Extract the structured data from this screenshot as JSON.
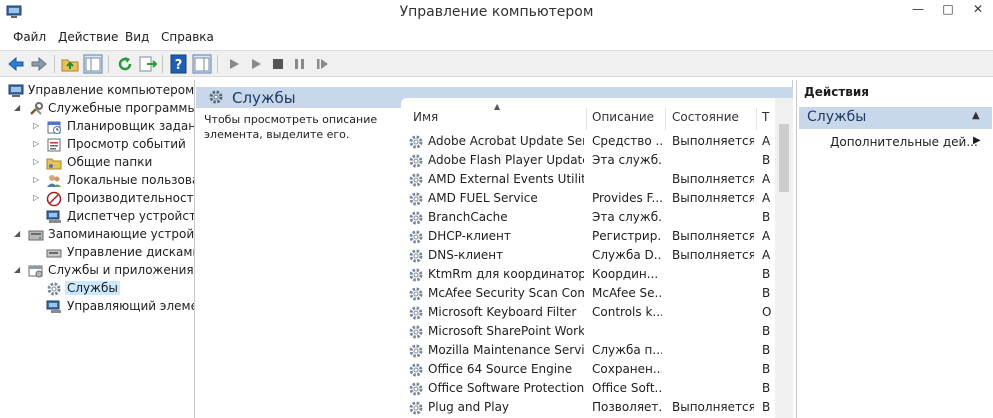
{
  "window": {
    "title": "Управление компьютером",
    "minimize": "—",
    "maximize": "□",
    "close": "✕"
  },
  "menu": [
    "Файл",
    "Действие",
    "Вид",
    "Справка"
  ],
  "tree": [
    {
      "label": "Управление компьютером (л",
      "icon": "computer-management-icon"
    },
    {
      "label": "Служебные программы",
      "icon": "tools-icon"
    },
    {
      "label": "Планировщик заданий",
      "icon": "task-scheduler-icon"
    },
    {
      "label": "Просмотр событий",
      "icon": "event-viewer-icon"
    },
    {
      "label": "Общие папки",
      "icon": "shared-folders-icon"
    },
    {
      "label": "Локальные пользовате",
      "icon": "local-users-icon"
    },
    {
      "label": "Производительность",
      "icon": "performance-icon"
    },
    {
      "label": "Диспетчер устройств",
      "icon": "device-manager-icon"
    },
    {
      "label": "Запоминающие устройст",
      "icon": "storage-icon"
    },
    {
      "label": "Управление дисками",
      "icon": "disk-management-icon"
    },
    {
      "label": "Службы и приложения",
      "icon": "services-apps-icon"
    },
    {
      "label": "Службы",
      "icon": "services-icon"
    },
    {
      "label": "Управляющий элемен",
      "icon": "wmi-control-icon"
    }
  ],
  "center": {
    "title": "Службы",
    "description": "Чтобы просмотреть описание элемента, выделите его."
  },
  "columns": [
    "Имя",
    "Описание",
    "Состояние",
    "Т"
  ],
  "services": [
    {
      "name": "Adobe Acrobat Update Serv...",
      "desc": "Средство ...",
      "state": "Выполняется",
      "type": "А"
    },
    {
      "name": "Adobe Flash Player Update ...",
      "desc": "Эта служб...",
      "state": "",
      "type": "В"
    },
    {
      "name": "AMD External Events Utility",
      "desc": "",
      "state": "Выполняется",
      "type": "А"
    },
    {
      "name": "AMD FUEL Service",
      "desc": "Provides F...",
      "state": "Выполняется",
      "type": "А"
    },
    {
      "name": "BranchCache",
      "desc": "Эта служб...",
      "state": "",
      "type": "В"
    },
    {
      "name": "DHCP-клиент",
      "desc": "Регистрир...",
      "state": "Выполняется",
      "type": "А"
    },
    {
      "name": "DNS-клиент",
      "desc": "Служба D...",
      "state": "Выполняется",
      "type": "А"
    },
    {
      "name": "KtmRm для координатора ...",
      "desc": "Координ...",
      "state": "",
      "type": "В"
    },
    {
      "name": "McAfee Security Scan Com...",
      "desc": "McAfee Se...",
      "state": "",
      "type": "В"
    },
    {
      "name": "Microsoft Keyboard Filter",
      "desc": "Controls k...",
      "state": "",
      "type": "О"
    },
    {
      "name": "Microsoft SharePoint Works...",
      "desc": "",
      "state": "",
      "type": "В"
    },
    {
      "name": "Mozilla Maintenance Service",
      "desc": "Служба п...",
      "state": "",
      "type": "В"
    },
    {
      "name": "Office 64 Source Engine",
      "desc": "Сохранен...",
      "state": "",
      "type": "В"
    },
    {
      "name": "Office Software Protection ...",
      "desc": "Office Soft...",
      "state": "",
      "type": "В"
    },
    {
      "name": "Plug and Play",
      "desc": "Позволяет...",
      "state": "Выполняется",
      "type": "В"
    }
  ],
  "actions": {
    "title": "Действия",
    "section": "Службы",
    "item": "Дополнительные дей..."
  }
}
